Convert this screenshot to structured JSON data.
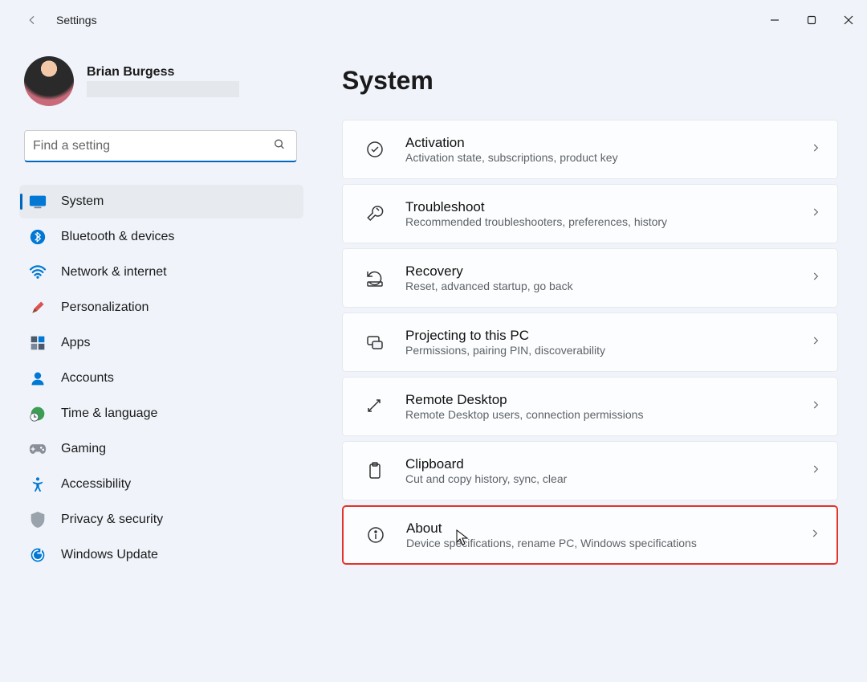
{
  "window": {
    "app_title": "Settings"
  },
  "profile": {
    "name": "Brian Burgess"
  },
  "search": {
    "placeholder": "Find a setting"
  },
  "sidebar": {
    "items": [
      {
        "label": "System"
      },
      {
        "label": "Bluetooth & devices"
      },
      {
        "label": "Network & internet"
      },
      {
        "label": "Personalization"
      },
      {
        "label": "Apps"
      },
      {
        "label": "Accounts"
      },
      {
        "label": "Time & language"
      },
      {
        "label": "Gaming"
      },
      {
        "label": "Accessibility"
      },
      {
        "label": "Privacy & security"
      },
      {
        "label": "Windows Update"
      }
    ]
  },
  "main": {
    "title": "System",
    "cards": [
      {
        "title": "Activation",
        "sub": "Activation state, subscriptions, product key"
      },
      {
        "title": "Troubleshoot",
        "sub": "Recommended troubleshooters, preferences, history"
      },
      {
        "title": "Recovery",
        "sub": "Reset, advanced startup, go back"
      },
      {
        "title": "Projecting to this PC",
        "sub": "Permissions, pairing PIN, discoverability"
      },
      {
        "title": "Remote Desktop",
        "sub": "Remote Desktop users, connection permissions"
      },
      {
        "title": "Clipboard",
        "sub": "Cut and copy history, sync, clear"
      },
      {
        "title": "About",
        "sub": "Device specifications, rename PC, Windows specifications"
      }
    ]
  }
}
